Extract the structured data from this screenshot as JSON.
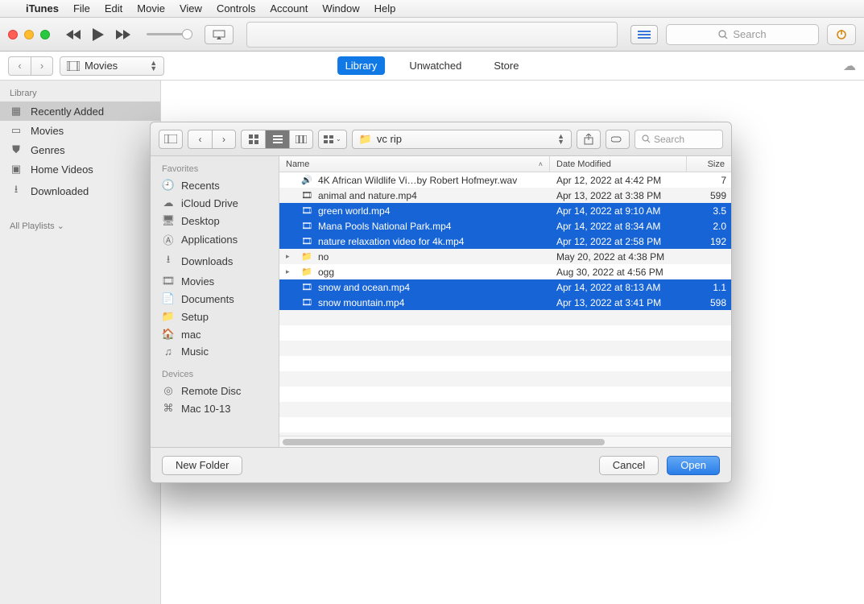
{
  "menubar": {
    "app": "iTunes",
    "items": [
      "File",
      "Edit",
      "Movie",
      "View",
      "Controls",
      "Account",
      "Window",
      "Help"
    ]
  },
  "toolbar": {
    "search_placeholder": "Search"
  },
  "subbar": {
    "media_label": "Movies",
    "tabs": {
      "library": "Library",
      "unwatched": "Unwatched",
      "store": "Store"
    }
  },
  "sidebar": {
    "header": "Library",
    "items": [
      {
        "label": "Recently Added"
      },
      {
        "label": "Movies"
      },
      {
        "label": "Genres"
      },
      {
        "label": "Home Videos"
      },
      {
        "label": "Downloaded"
      }
    ],
    "all_playlists": "All Playlists"
  },
  "finder": {
    "path": "vc rip",
    "search_placeholder": "Search",
    "sidebar": {
      "favorites": "Favorites",
      "fav_items": [
        "Recents",
        "iCloud Drive",
        "Desktop",
        "Applications",
        "Downloads",
        "Movies",
        "Documents",
        "Setup",
        "mac",
        "Music"
      ],
      "devices": "Devices",
      "dev_items": [
        "Remote Disc",
        "Mac 10-13"
      ]
    },
    "columns": {
      "name": "Name",
      "date": "Date Modified",
      "size": "Size"
    },
    "rows": [
      {
        "name": "4K African Wildlife Vi…by Robert Hofmeyr.wav",
        "date": "Apr 12, 2022 at 4:42 PM",
        "size": "7",
        "sel": false,
        "folder": false,
        "icon": "audio"
      },
      {
        "name": "animal and nature.mp4",
        "date": "Apr 13, 2022 at 3:38 PM",
        "size": "599",
        "sel": false,
        "folder": false,
        "icon": "video"
      },
      {
        "name": "green world.mp4",
        "date": "Apr 14, 2022 at 9:10 AM",
        "size": "3.5",
        "sel": true,
        "folder": false,
        "icon": "video"
      },
      {
        "name": "Mana Pools National Park.mp4",
        "date": "Apr 14, 2022 at 8:34 AM",
        "size": "2.0",
        "sel": true,
        "folder": false,
        "icon": "video"
      },
      {
        "name": "nature relaxation video for 4k.mp4",
        "date": "Apr 12, 2022 at 2:58 PM",
        "size": "192",
        "sel": true,
        "folder": false,
        "icon": "video"
      },
      {
        "name": "no",
        "date": "May 20, 2022 at 4:38 PM",
        "size": "",
        "sel": false,
        "folder": true,
        "icon": "folder"
      },
      {
        "name": "ogg",
        "date": "Aug 30, 2022 at 4:56 PM",
        "size": "",
        "sel": false,
        "folder": true,
        "icon": "folder"
      },
      {
        "name": "snow and ocean.mp4",
        "date": "Apr 14, 2022 at 8:13 AM",
        "size": "1.1",
        "sel": true,
        "folder": false,
        "icon": "video"
      },
      {
        "name": "snow mountain.mp4",
        "date": "Apr 13, 2022 at 3:41 PM",
        "size": "598",
        "sel": true,
        "folder": false,
        "icon": "video"
      }
    ],
    "footer": {
      "new_folder": "New Folder",
      "cancel": "Cancel",
      "open": "Open"
    }
  }
}
